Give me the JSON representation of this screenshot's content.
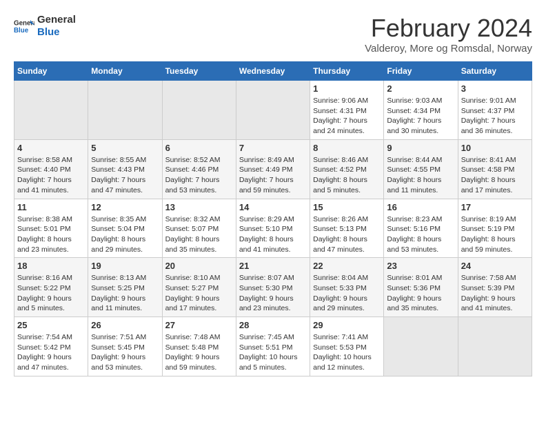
{
  "logo": {
    "line1": "General",
    "line2": "Blue"
  },
  "title": "February 2024",
  "subtitle": "Valderoy, More og Romsdal, Norway",
  "weekdays": [
    "Sunday",
    "Monday",
    "Tuesday",
    "Wednesday",
    "Thursday",
    "Friday",
    "Saturday"
  ],
  "weeks": [
    [
      {
        "day": "",
        "empty": true
      },
      {
        "day": "",
        "empty": true
      },
      {
        "day": "",
        "empty": true
      },
      {
        "day": "",
        "empty": true
      },
      {
        "day": "1",
        "sunrise": "9:06 AM",
        "sunset": "4:31 PM",
        "daylight": "7 hours and 24 minutes."
      },
      {
        "day": "2",
        "sunrise": "9:03 AM",
        "sunset": "4:34 PM",
        "daylight": "7 hours and 30 minutes."
      },
      {
        "day": "3",
        "sunrise": "9:01 AM",
        "sunset": "4:37 PM",
        "daylight": "7 hours and 36 minutes."
      }
    ],
    [
      {
        "day": "4",
        "sunrise": "8:58 AM",
        "sunset": "4:40 PM",
        "daylight": "7 hours and 41 minutes."
      },
      {
        "day": "5",
        "sunrise": "8:55 AM",
        "sunset": "4:43 PM",
        "daylight": "7 hours and 47 minutes."
      },
      {
        "day": "6",
        "sunrise": "8:52 AM",
        "sunset": "4:46 PM",
        "daylight": "7 hours and 53 minutes."
      },
      {
        "day": "7",
        "sunrise": "8:49 AM",
        "sunset": "4:49 PM",
        "daylight": "7 hours and 59 minutes."
      },
      {
        "day": "8",
        "sunrise": "8:46 AM",
        "sunset": "4:52 PM",
        "daylight": "8 hours and 5 minutes."
      },
      {
        "day": "9",
        "sunrise": "8:44 AM",
        "sunset": "4:55 PM",
        "daylight": "8 hours and 11 minutes."
      },
      {
        "day": "10",
        "sunrise": "8:41 AM",
        "sunset": "4:58 PM",
        "daylight": "8 hours and 17 minutes."
      }
    ],
    [
      {
        "day": "11",
        "sunrise": "8:38 AM",
        "sunset": "5:01 PM",
        "daylight": "8 hours and 23 minutes."
      },
      {
        "day": "12",
        "sunrise": "8:35 AM",
        "sunset": "5:04 PM",
        "daylight": "8 hours and 29 minutes."
      },
      {
        "day": "13",
        "sunrise": "8:32 AM",
        "sunset": "5:07 PM",
        "daylight": "8 hours and 35 minutes."
      },
      {
        "day": "14",
        "sunrise": "8:29 AM",
        "sunset": "5:10 PM",
        "daylight": "8 hours and 41 minutes."
      },
      {
        "day": "15",
        "sunrise": "8:26 AM",
        "sunset": "5:13 PM",
        "daylight": "8 hours and 47 minutes."
      },
      {
        "day": "16",
        "sunrise": "8:23 AM",
        "sunset": "5:16 PM",
        "daylight": "8 hours and 53 minutes."
      },
      {
        "day": "17",
        "sunrise": "8:19 AM",
        "sunset": "5:19 PM",
        "daylight": "8 hours and 59 minutes."
      }
    ],
    [
      {
        "day": "18",
        "sunrise": "8:16 AM",
        "sunset": "5:22 PM",
        "daylight": "9 hours and 5 minutes."
      },
      {
        "day": "19",
        "sunrise": "8:13 AM",
        "sunset": "5:25 PM",
        "daylight": "9 hours and 11 minutes."
      },
      {
        "day": "20",
        "sunrise": "8:10 AM",
        "sunset": "5:27 PM",
        "daylight": "9 hours and 17 minutes."
      },
      {
        "day": "21",
        "sunrise": "8:07 AM",
        "sunset": "5:30 PM",
        "daylight": "9 hours and 23 minutes."
      },
      {
        "day": "22",
        "sunrise": "8:04 AM",
        "sunset": "5:33 PM",
        "daylight": "9 hours and 29 minutes."
      },
      {
        "day": "23",
        "sunrise": "8:01 AM",
        "sunset": "5:36 PM",
        "daylight": "9 hours and 35 minutes."
      },
      {
        "day": "24",
        "sunrise": "7:58 AM",
        "sunset": "5:39 PM",
        "daylight": "9 hours and 41 minutes."
      }
    ],
    [
      {
        "day": "25",
        "sunrise": "7:54 AM",
        "sunset": "5:42 PM",
        "daylight": "9 hours and 47 minutes."
      },
      {
        "day": "26",
        "sunrise": "7:51 AM",
        "sunset": "5:45 PM",
        "daylight": "9 hours and 53 minutes."
      },
      {
        "day": "27",
        "sunrise": "7:48 AM",
        "sunset": "5:48 PM",
        "daylight": "9 hours and 59 minutes."
      },
      {
        "day": "28",
        "sunrise": "7:45 AM",
        "sunset": "5:51 PM",
        "daylight": "10 hours and 5 minutes."
      },
      {
        "day": "29",
        "sunrise": "7:41 AM",
        "sunset": "5:53 PM",
        "daylight": "10 hours and 12 minutes."
      },
      {
        "day": "",
        "empty": true
      },
      {
        "day": "",
        "empty": true
      }
    ]
  ]
}
